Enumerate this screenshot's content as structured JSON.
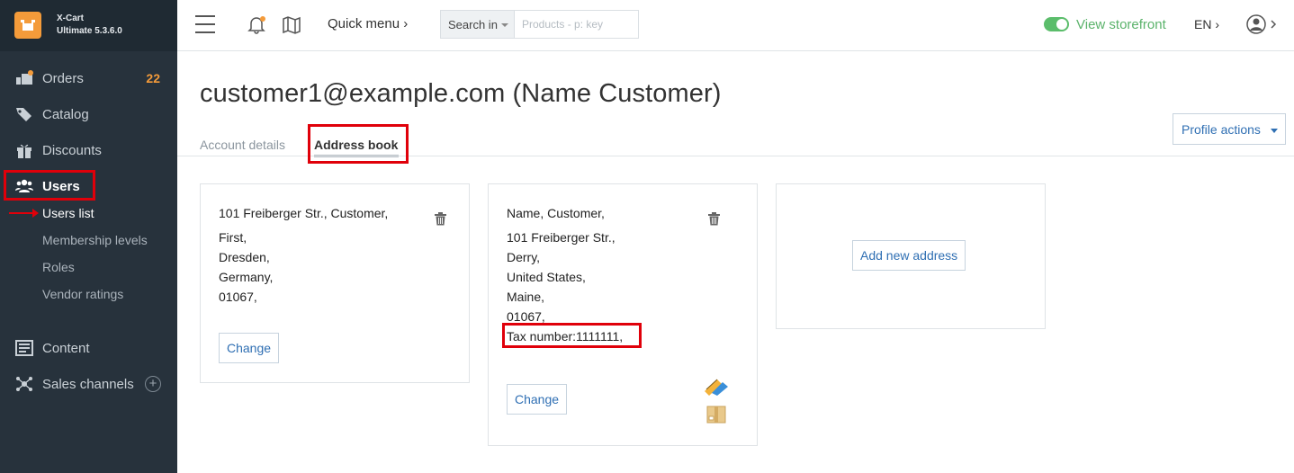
{
  "brand": {
    "name": "X-Cart",
    "version": "Ultimate 5.3.6.0"
  },
  "sidebar": {
    "items": [
      {
        "label": "Orders",
        "count": "22"
      },
      {
        "label": "Catalog"
      },
      {
        "label": "Discounts"
      },
      {
        "label": "Users"
      },
      {
        "label": "Content"
      },
      {
        "label": "Sales channels"
      }
    ],
    "users_sub": [
      "Users list",
      "Membership levels",
      "Roles",
      "Vendor ratings"
    ]
  },
  "header": {
    "quick_menu": "Quick menu",
    "search_in": "Search in",
    "search_placeholder": "Products - p: key",
    "storefront": "View storefront",
    "lang": "EN"
  },
  "page": {
    "title": "customer1@example.com (Name Customer)",
    "profile_actions": "Profile actions",
    "tabs": [
      "Account details",
      "Address book"
    ]
  },
  "addresses": [
    {
      "lines": [
        "101 Freiberger Str., Customer,",
        "First,",
        "Dresden,",
        "Germany,",
        "01067,"
      ],
      "change": "Change"
    },
    {
      "lines": [
        "Name, Customer,",
        "101 Freiberger Str.,",
        "Derry,",
        "United States,",
        "Maine,",
        "01067,",
        "Tax number:1111111,"
      ],
      "change": "Change"
    }
  ],
  "add_new": "Add new address",
  "colors": {
    "accent": "#f49b3a",
    "sidebar": "#27323c",
    "link": "#2f6fb3",
    "highlight": "#e0000a",
    "storefront": "#5bb36b"
  }
}
